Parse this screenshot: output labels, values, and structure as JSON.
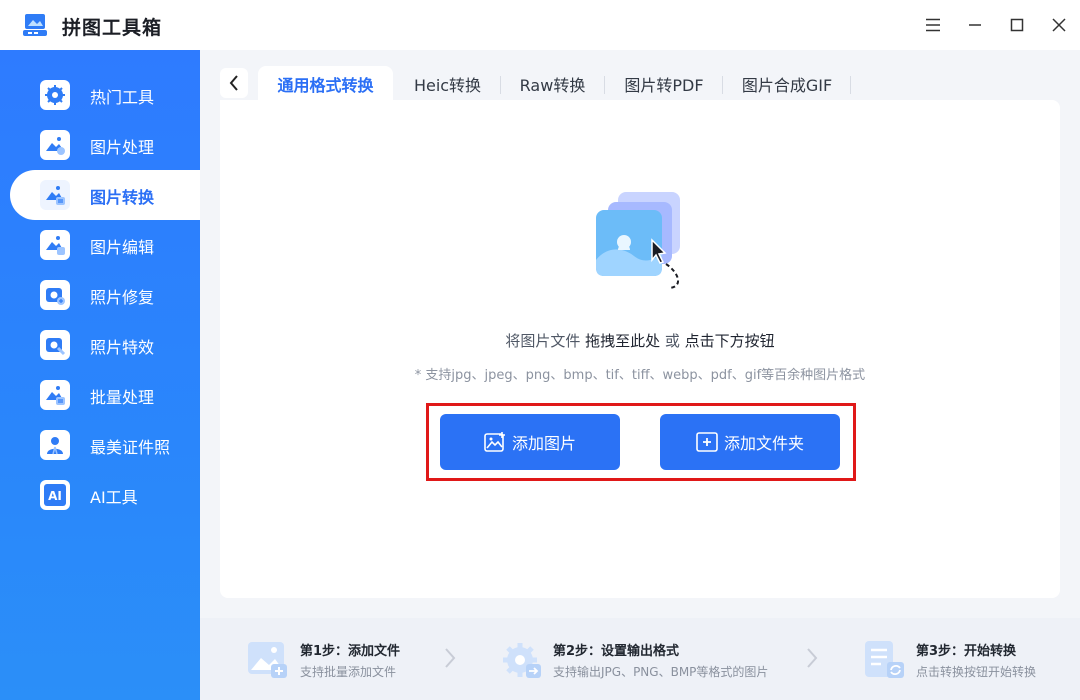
{
  "app": {
    "title": "拼图工具箱"
  },
  "sidebar": {
    "items": [
      {
        "label": "热门工具",
        "icon": "gear-icon"
      },
      {
        "label": "图片处理",
        "icon": "image-process-icon"
      },
      {
        "label": "图片转换",
        "icon": "image-convert-icon",
        "active": true
      },
      {
        "label": "图片编辑",
        "icon": "image-edit-icon"
      },
      {
        "label": "照片修复",
        "icon": "photo-repair-icon"
      },
      {
        "label": "照片特效",
        "icon": "photo-effect-icon"
      },
      {
        "label": "批量处理",
        "icon": "batch-process-icon"
      },
      {
        "label": "最美证件照",
        "icon": "id-photo-icon"
      },
      {
        "label": "AI工具",
        "icon": "ai-icon"
      }
    ]
  },
  "tabs": [
    {
      "label": "通用格式转换",
      "active": true
    },
    {
      "label": "Heic转换"
    },
    {
      "label": "Raw转换"
    },
    {
      "label": "图片转PDF"
    },
    {
      "label": "图片合成GIF"
    }
  ],
  "dropzone": {
    "text_prefix": "将图片文件 ",
    "text_drag": "拖拽至此处",
    "text_or": " 或 ",
    "text_click": "点击下方按钮",
    "formats_hint": "* 支持jpg、jpeg、png、bmp、tif、tiff、webp、pdf、gif等百余种图片格式"
  },
  "buttons": {
    "add_image": "添加图片",
    "add_folder": "添加文件夹"
  },
  "steps": [
    {
      "title": "第1步：添加文件",
      "desc": "支持批量添加文件"
    },
    {
      "title": "第2步：设置输出格式",
      "desc": "支持输出JPG、PNG、BMP等格式的图片"
    },
    {
      "title": "第3步：开始转换",
      "desc": "点击转换按钮开始转换"
    }
  ],
  "colors": {
    "accent": "#2b72f5",
    "sidebar": "#2e7bff",
    "highlight": "#e01818"
  }
}
